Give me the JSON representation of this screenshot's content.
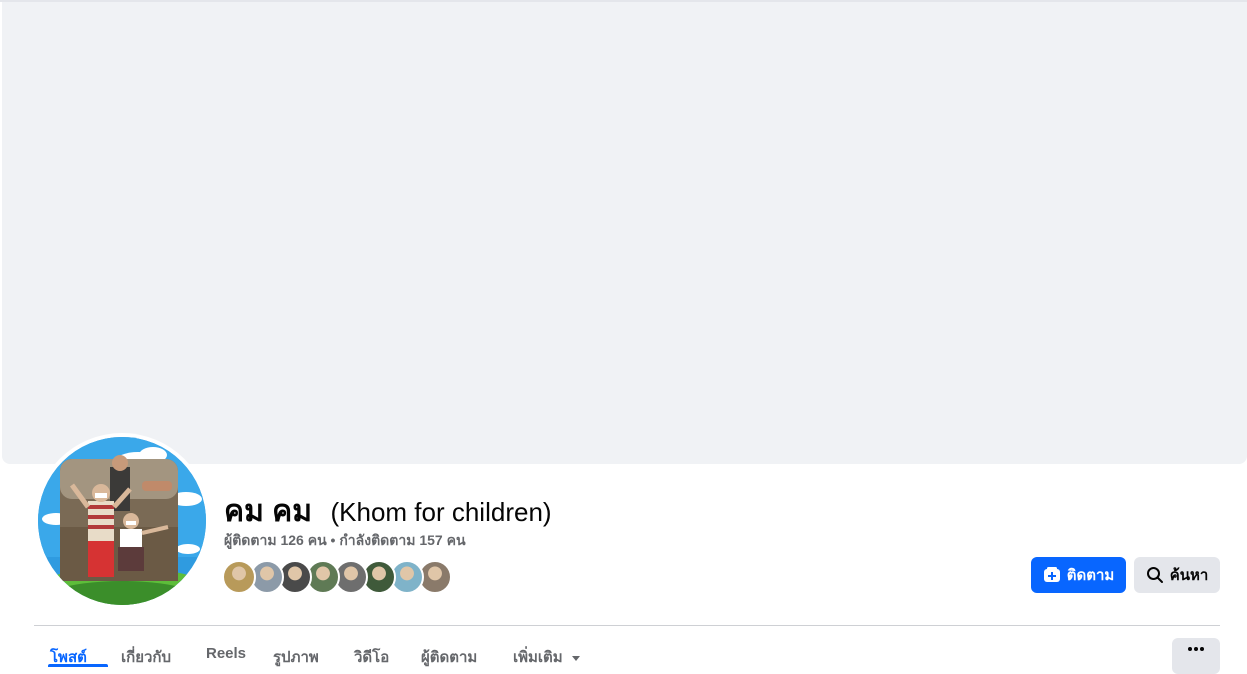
{
  "profile": {
    "name": "คม คม",
    "alternate_name": "(Khom for children)",
    "stats": "ผู้ติดตาม 126 คน • กำลังติดตาม 157 คน",
    "friend_avatar_colors": [
      "#b89a5a",
      "#8c9aa8",
      "#4a4a4a",
      "#5f7a55",
      "#6e6e6e",
      "#3f5a3a",
      "#7fb3c9",
      "#8a7a6a"
    ]
  },
  "actions": {
    "follow_label": "ติดตาม",
    "search_label": "ค้นหา"
  },
  "tabs": [
    {
      "label": "โพสต์",
      "active": true
    },
    {
      "label": "เกี่ยวกับ"
    },
    {
      "label": "Reels"
    },
    {
      "label": "รูปภาพ"
    },
    {
      "label": "วิดีโอ"
    },
    {
      "label": "ผู้ติดตาม"
    },
    {
      "label": "เพิ่มเติม"
    }
  ],
  "colors": {
    "accent": "#0866ff",
    "cover": "#f0f2f5",
    "secondary_button": "#e4e6eb",
    "muted_text": "#65676b"
  }
}
